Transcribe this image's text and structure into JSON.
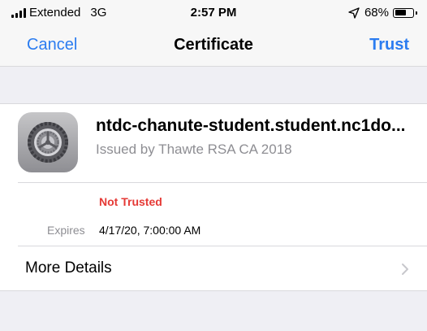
{
  "status_bar": {
    "carrier": "Extended",
    "network": "3G",
    "time": "2:57 PM",
    "battery_percent": "68%",
    "battery_level": 0.68,
    "location_icon": "location-arrow-icon",
    "signal_icon": "signal-bars-icon",
    "battery_icon": "battery-icon"
  },
  "nav": {
    "cancel_label": "Cancel",
    "title": "Certificate",
    "trust_label": "Trust"
  },
  "certificate": {
    "icon": "certificate-gear-icon",
    "name": "ntdc-chanute-student.student.nc1do...",
    "issuer": "Issued by Thawte RSA CA 2018",
    "status": "Not Trusted",
    "expires_label": "Expires",
    "expires_value": "4/17/20, 7:00:00 AM"
  },
  "more_details": {
    "label": "More Details",
    "icon": "chevron-right-icon"
  },
  "colors": {
    "accent": "#2b7cf0",
    "untrusted": "#e53935",
    "secondary_text": "#8e8e93",
    "grouped_background": "#efeff4"
  }
}
